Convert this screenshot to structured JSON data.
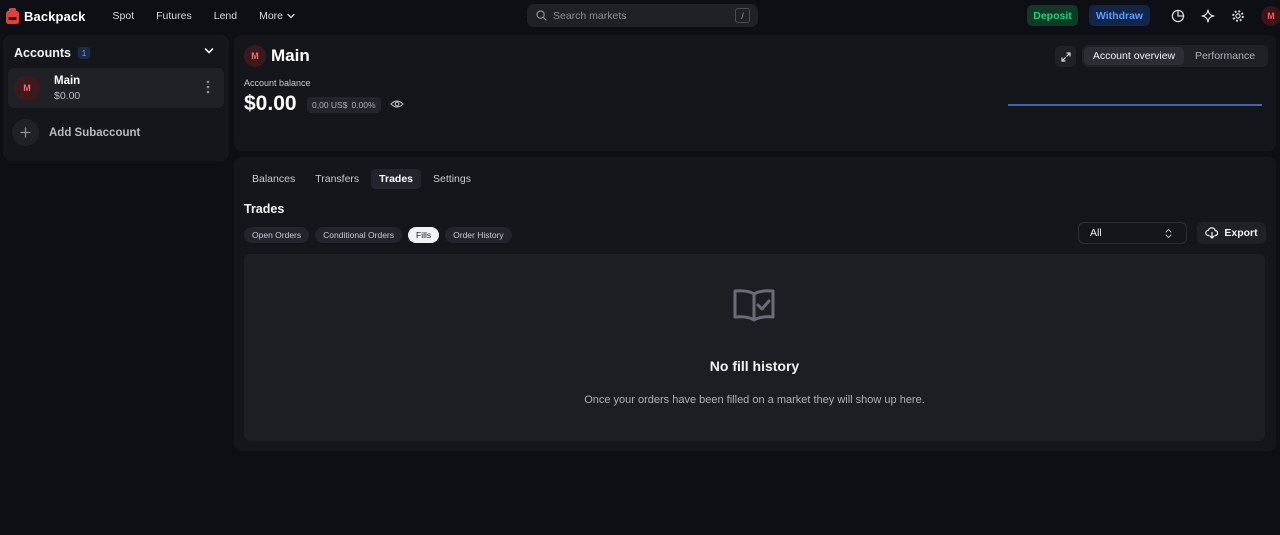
{
  "brand": {
    "name": "Backpack",
    "logo_icon": "backpack-logo-icon",
    "accent": "#e33e3f"
  },
  "nav": {
    "items": [
      "Spot",
      "Futures",
      "Lend"
    ],
    "more_label": "More"
  },
  "search": {
    "placeholder": "Search markets",
    "shortcut": "/"
  },
  "header_actions": {
    "deposit_label": "Deposit",
    "withdraw_label": "Withdraw",
    "icons": [
      "pie-chart-icon",
      "sparkle-icon",
      "settings-gear-icon"
    ],
    "avatar_initial": "M"
  },
  "sidebar": {
    "title": "Accounts",
    "count": "1",
    "account": {
      "initial": "M",
      "name": "Main",
      "balance": "$0.00"
    },
    "add_subaccount_label": "Add Subaccount"
  },
  "overview": {
    "avatar_initial": "M",
    "title": "Main",
    "balance_label": "Account balance",
    "balance": "$0.00",
    "change_amount": "0,00 US$",
    "change_percent": "0.00%",
    "tabs": {
      "active": "Account overview",
      "other": "Performance"
    }
  },
  "main": {
    "tabs": [
      {
        "label": "Balances",
        "active": false
      },
      {
        "label": "Transfers",
        "active": false
      },
      {
        "label": "Trades",
        "active": true
      },
      {
        "label": "Settings",
        "active": false
      }
    ],
    "section_title": "Trades",
    "filter_pills": [
      {
        "label": "Open Orders",
        "active": false
      },
      {
        "label": "Conditional Orders",
        "active": false
      },
      {
        "label": "Fills",
        "active": true
      },
      {
        "label": "Order History",
        "active": false
      }
    ],
    "market_filter": "All",
    "export_label": "Export",
    "empty_state": {
      "title": "No fill history",
      "description": "Once your orders have been filled on a market they will show up here."
    }
  }
}
